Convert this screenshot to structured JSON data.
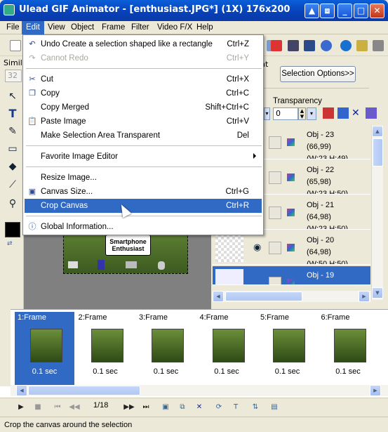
{
  "window": {
    "title": "Ulead GIF Animator - [enthusiast.JPG*] (1X) 176x200",
    "buttons": [
      "▲",
      "⧈",
      "_",
      "□",
      "✕"
    ]
  },
  "menubar": [
    "File",
    "Edit",
    "View",
    "Object",
    "Frame",
    "Filter",
    "Video F/X",
    "Help"
  ],
  "toolbar_partial": {
    "simila_label": "Simila",
    "value_32": "32",
    "nt_label": "nt"
  },
  "selection_options_button": "Selection Options>>",
  "transparency": {
    "label": "Transparency",
    "value": "0"
  },
  "edit_menu": [
    {
      "label": "Undo Create a selection shaped like a rectangle",
      "shortcut": "Ctrl+Z",
      "disabled": false,
      "icon": "undo-icon"
    },
    {
      "label": "Cannot Redo",
      "shortcut": "Ctrl+Y",
      "disabled": true,
      "icon": "redo-icon"
    },
    {
      "sep": true
    },
    {
      "label": "Cut",
      "shortcut": "Ctrl+X",
      "icon": "scissors-icon"
    },
    {
      "label": "Copy",
      "shortcut": "Ctrl+C",
      "icon": "copy-icon"
    },
    {
      "label": "Copy Merged",
      "shortcut": "Shift+Ctrl+C"
    },
    {
      "label": "Paste Image",
      "shortcut": "Ctrl+V",
      "icon": "paste-icon"
    },
    {
      "label": "Make Selection Area Transparent",
      "shortcut": "Del"
    },
    {
      "sep": true
    },
    {
      "label": "Favorite Image Editor",
      "submenu": true
    },
    {
      "sep": true
    },
    {
      "label": "Resize Image...",
      "shortcut": ""
    },
    {
      "label": "Canvas Size...",
      "shortcut": "Ctrl+G",
      "icon": "canvas-size-icon"
    },
    {
      "label": "Crop Canvas",
      "shortcut": "Ctrl+R",
      "highlighted": true
    },
    {
      "sep": true
    },
    {
      "label": "Global Information...",
      "icon": "info-icon"
    }
  ],
  "canvas_image": {
    "label_line1": "Smartphone",
    "label_line2": "Enthusiast"
  },
  "objects": [
    {
      "name": "Obj - 23",
      "info": "(66,99)(W:23,H:49)",
      "selected": false
    },
    {
      "name": "Obj - 22",
      "info": "(65,98)(W:23,H:50)",
      "selected": false
    },
    {
      "name": "Obj - 21",
      "info": "(64,98)(W:23,H:50)",
      "selected": false
    },
    {
      "name": "Obj - 20",
      "info": "(64,98)(W:50,H:50)",
      "selected": false
    },
    {
      "name": "Obj - 19",
      "info": "",
      "selected": true
    }
  ],
  "frames": [
    {
      "label": "1:Frame",
      "duration": "0.1 sec",
      "selected": true
    },
    {
      "label": "2:Frame",
      "duration": "0.1 sec",
      "selected": false
    },
    {
      "label": "3:Frame",
      "duration": "0.1 sec",
      "selected": false
    },
    {
      "label": "4:Frame",
      "duration": "0.1 sec",
      "selected": false
    },
    {
      "label": "5:Frame",
      "duration": "0.1 sec",
      "selected": false
    },
    {
      "label": "6:Frame",
      "duration": "0.1 sec",
      "selected": false
    }
  ],
  "playback": {
    "counter": "1/18"
  },
  "status": "Crop the canvas around the selection",
  "colors": {
    "title_blue": "#0a5fd8",
    "highlight": "#316ac5",
    "face": "#ece9d8"
  }
}
